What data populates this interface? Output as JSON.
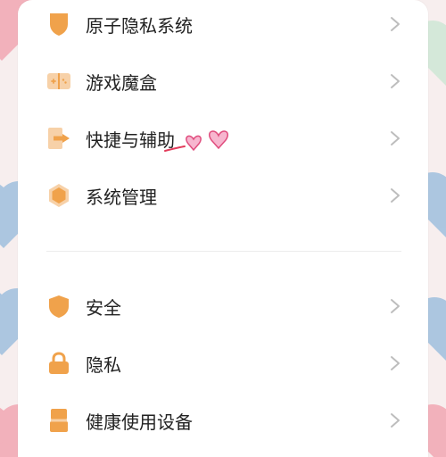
{
  "colors": {
    "accent": "#F0A24B",
    "text": "#222222",
    "chevron": "#BDBDBD",
    "card": "#FFFFFF"
  },
  "settings": {
    "group1": [
      {
        "label": "原子隐私系统",
        "icon": "shield-partial-icon"
      },
      {
        "label": "游戏魔盒",
        "icon": "game-box-icon"
      },
      {
        "label": "快捷与辅助",
        "icon": "shortcut-arrow-icon"
      },
      {
        "label": "系统管理",
        "icon": "hexagon-icon"
      }
    ],
    "group2": [
      {
        "label": "安全",
        "icon": "shield-icon"
      },
      {
        "label": "隐私",
        "icon": "lock-icon"
      },
      {
        "label": "健康使用设备",
        "icon": "hourglass-icon"
      }
    ]
  },
  "decorations": {
    "doodle": "pink-hearts-doodle"
  }
}
